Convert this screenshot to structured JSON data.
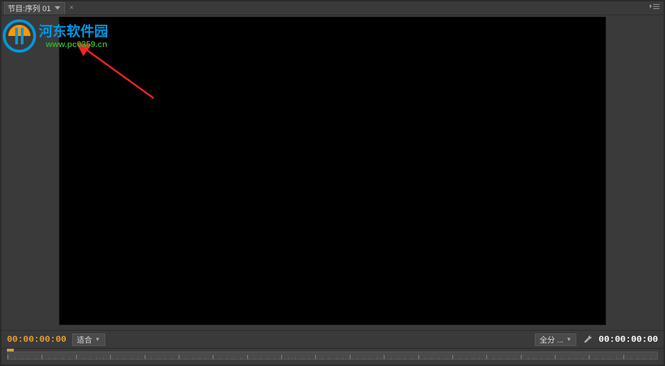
{
  "tab": {
    "prefix": "节目:",
    "title": "序列 01"
  },
  "timecode_left": "00:00:00:00",
  "timecode_right": "00:00:00:00",
  "zoom_dropdown": {
    "label": "适合"
  },
  "resolution_dropdown": {
    "label": "全分 ..."
  },
  "watermark": {
    "text": "河东软件园",
    "url": "www.pc0359.cn"
  },
  "colors": {
    "timecode_gold": "#e8a030",
    "panel_bg": "#3a3a3a",
    "video_bg": "#000000"
  }
}
